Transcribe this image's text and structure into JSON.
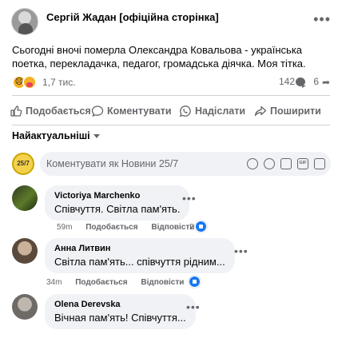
{
  "post": {
    "page_name": "Сергій Жадан [офіційна сторінка]",
    "time": "",
    "text": "Сьогодні вночі померла Олександра Ковальова - українська поетка, перекладачка, педагог, громадська діячка. Моя тітка.",
    "reactions_count": "1,7 тис.",
    "comments_count": "142",
    "shares_count": "6"
  },
  "actions": {
    "like": "Подобається",
    "comment": "Коментувати",
    "send": "Надіслати",
    "share": "Поширити"
  },
  "sort_label": "Найактуальніші",
  "composer": {
    "avatar_text": "25/7",
    "placeholder": "Коментувати як Новини 25/7"
  },
  "comments": [
    {
      "name": "Victoriya Marchenko",
      "text": "Співчуття. Світла пам'ять.",
      "time": "59m",
      "like": "Подобається",
      "reply": "Відповісти",
      "likes": "2"
    },
    {
      "name": "Анна Литвин",
      "text": "Світла пам'ять... співчуття рідним...",
      "time": "34m",
      "like": "Подобається",
      "reply": "Відповісти",
      "likes": ""
    },
    {
      "name": "Olena Derevska",
      "text": "Вічная пам'ять! Співчуття...",
      "time": "",
      "like": "",
      "reply": "",
      "likes": ""
    }
  ],
  "colors": {
    "accent": "#1877f2",
    "muted": "#65676b",
    "bubble": "#f0f2f5"
  },
  "icons": [
    "more-icon",
    "thumbs-up-icon",
    "comment-icon",
    "whatsapp-icon",
    "share-icon",
    "sticker-icon",
    "emoji-icon",
    "camera-icon",
    "gif-icon",
    "sticker-square-icon"
  ]
}
